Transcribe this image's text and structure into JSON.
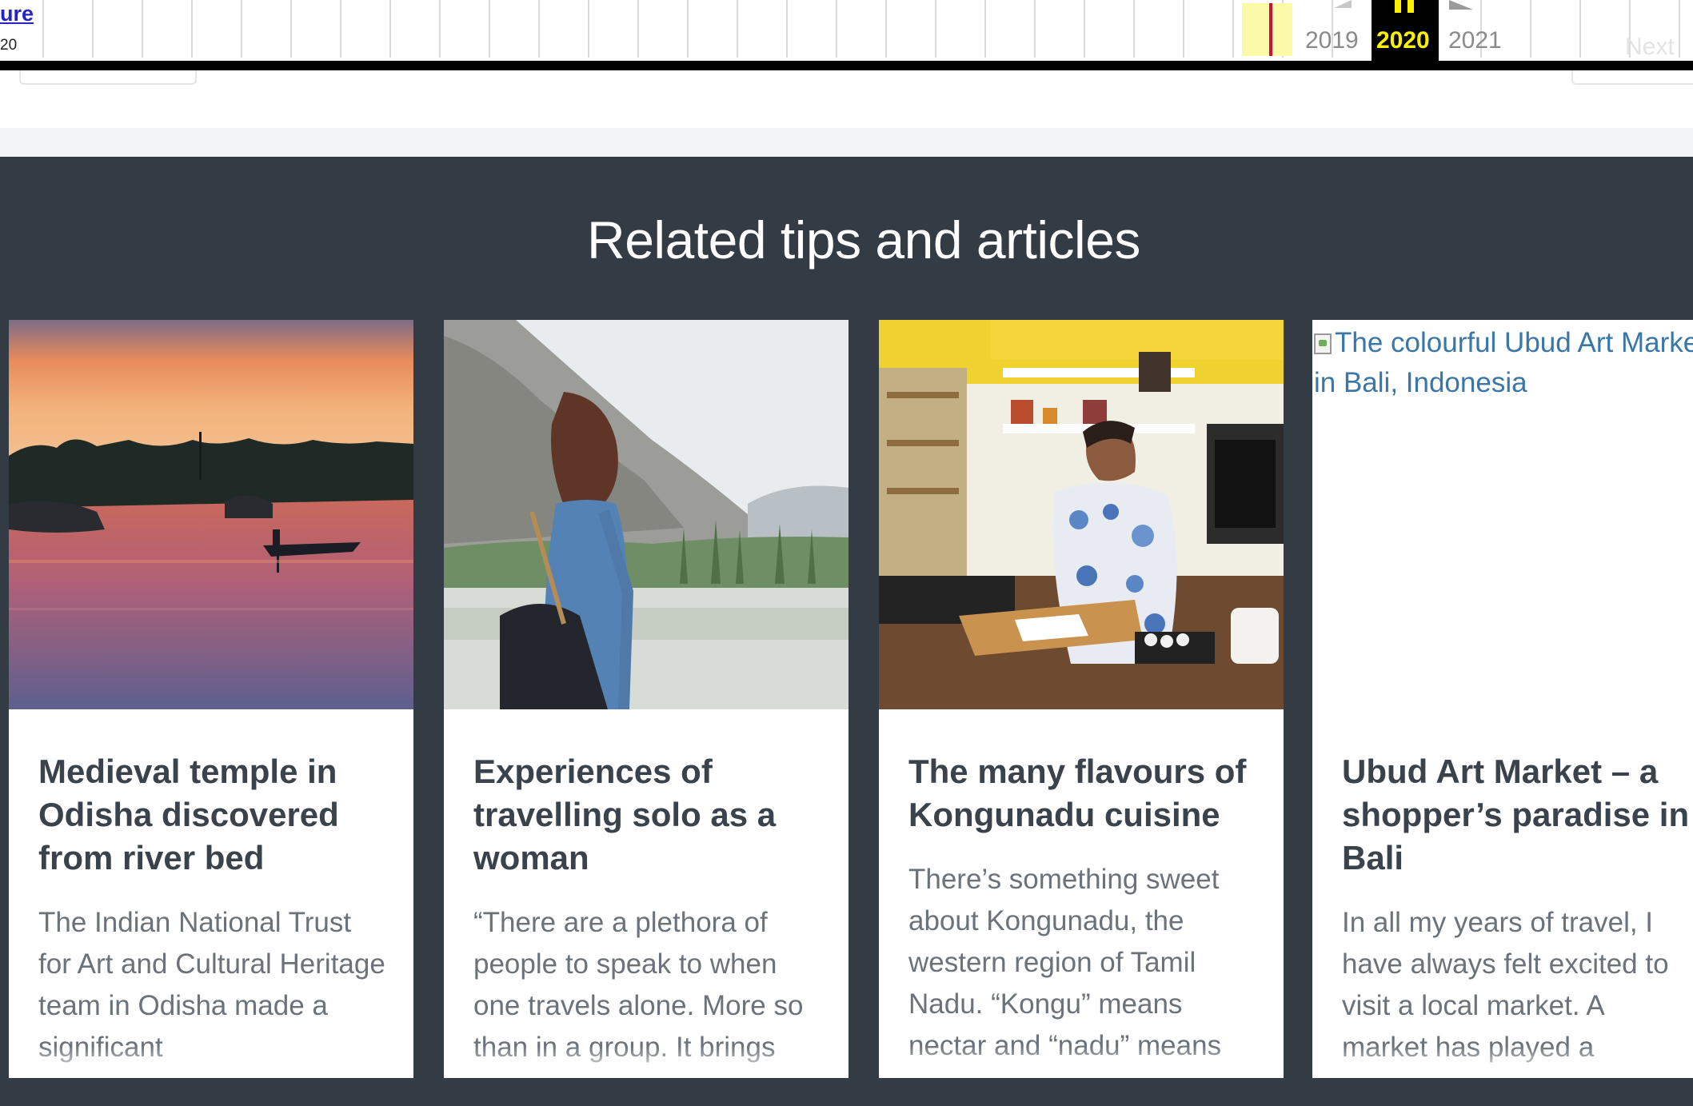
{
  "wayback": {
    "link_text": "ure",
    "small_text": "20",
    "prev_year": "2019",
    "current_year": "2020",
    "next_year": "2021",
    "next_label": "Next",
    "accent_color": "#f9f100",
    "marker_color": "#d0103a"
  },
  "related": {
    "heading": "Related tips and articles",
    "background": "#333b45",
    "cards": [
      {
        "image": "sunset-river-boat-image",
        "title": "Medieval temple in Odisha discovered from river bed",
        "excerpt": "The Indian National Trust for Art and Cultural Heritage team in Odisha made a significant"
      },
      {
        "image": "solo-traveller-mountains-image",
        "title": "Experiences of travelling solo as a woman",
        "excerpt": "“There are a plethora of people to speak to when one travels alone. More so than in a group. It brings"
      },
      {
        "image": "chef-in-kitchen-image",
        "title": "The many flavours of Kongunadu cuisine",
        "excerpt": "There’s something sweet about Kongunadu, the western region of Tamil Nadu. “Kongu” means nectar and “nadu” means"
      },
      {
        "image": "broken-image",
        "image_alt": "The colourful Ubud Art Market in Bali, Indonesia",
        "title": "Ubud Art Market – a shopper’s paradise in Bali",
        "excerpt": "In all my years of travel, I have always felt excited to visit a local market. A market has played a"
      }
    ]
  }
}
